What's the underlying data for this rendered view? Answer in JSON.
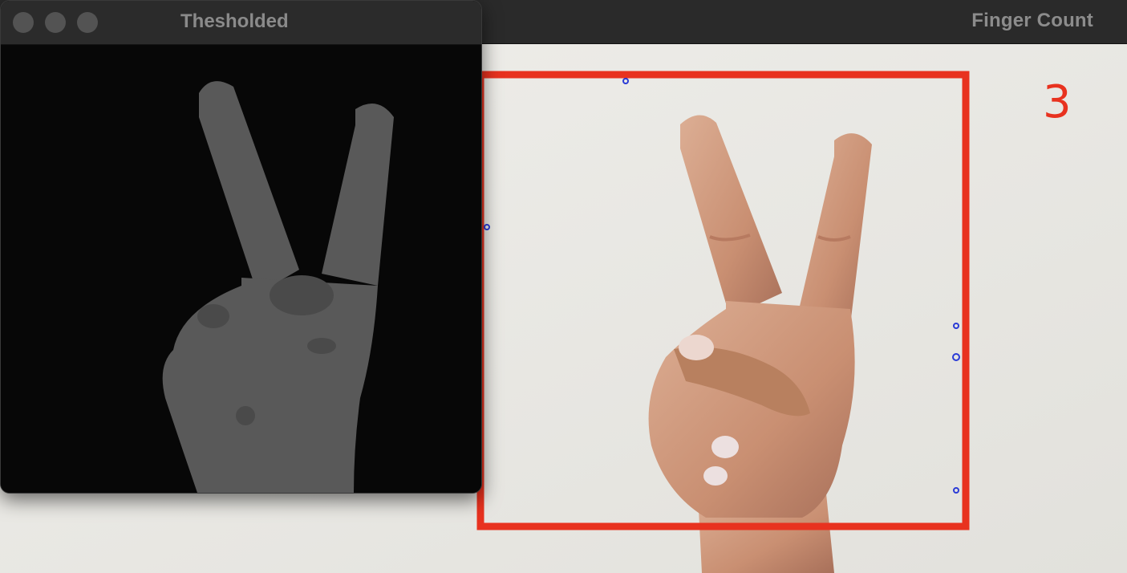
{
  "main_window": {
    "title": "Finger Count",
    "finger_count": "3"
  },
  "threshold_window": {
    "title": "Thesholded"
  },
  "colors": {
    "roi_box": "#e8321f",
    "count_text": "#e8321f",
    "wall": "#e9e8e4",
    "skin": "#d9a58a",
    "mask_fg": "#5a5a5a",
    "mask_bg": "#060606"
  }
}
